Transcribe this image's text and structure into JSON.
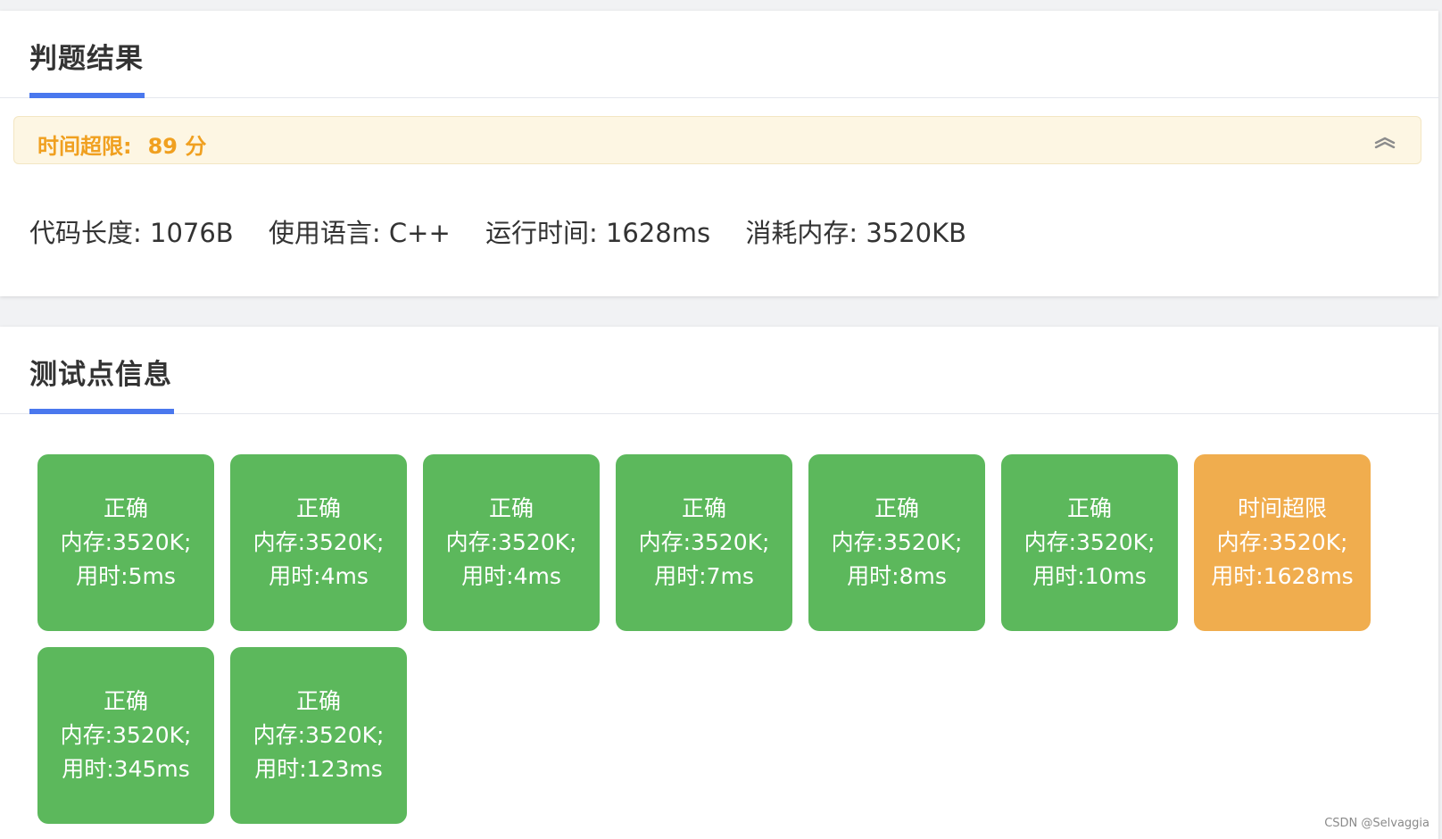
{
  "result_card": {
    "title": "判题结果",
    "verdict_label": "时间超限:",
    "verdict_score": "89 分",
    "meta": [
      {
        "label": "代码长度: 1076B"
      },
      {
        "label": "使用语言: C++"
      },
      {
        "label": "运行时间: 1628ms"
      },
      {
        "label": "消耗内存: 3520KB"
      }
    ],
    "collapse_icon": "double-chevron-up-icon"
  },
  "tests_card": {
    "title": "测试点信息",
    "tests": [
      {
        "status": "正确",
        "memory": "内存:3520K;",
        "time": "用时:5ms",
        "state": "ok"
      },
      {
        "status": "正确",
        "memory": "内存:3520K;",
        "time": "用时:4ms",
        "state": "ok"
      },
      {
        "status": "正确",
        "memory": "内存:3520K;",
        "time": "用时:4ms",
        "state": "ok"
      },
      {
        "status": "正确",
        "memory": "内存:3520K;",
        "time": "用时:7ms",
        "state": "ok"
      },
      {
        "status": "正确",
        "memory": "内存:3520K;",
        "time": "用时:8ms",
        "state": "ok"
      },
      {
        "status": "正确",
        "memory": "内存:3520K;",
        "time": "用时:10ms",
        "state": "ok"
      },
      {
        "status": "时间超限",
        "memory": "内存:3520K;",
        "time": "用时:1628ms",
        "state": "tle"
      },
      {
        "status": "正确",
        "memory": "内存:3520K;",
        "time": "用时:345ms",
        "state": "ok"
      },
      {
        "status": "正确",
        "memory": "内存:3520K;",
        "time": "用时:123ms",
        "state": "ok"
      }
    ]
  },
  "colors": {
    "accent": "#4a78ee",
    "ok": "#5cb85c",
    "tle": "#f0ad4e",
    "verdict_text": "#f0a020",
    "verdict_bg": "#fdf6e3"
  },
  "watermark": "CSDN @Selvaggia"
}
